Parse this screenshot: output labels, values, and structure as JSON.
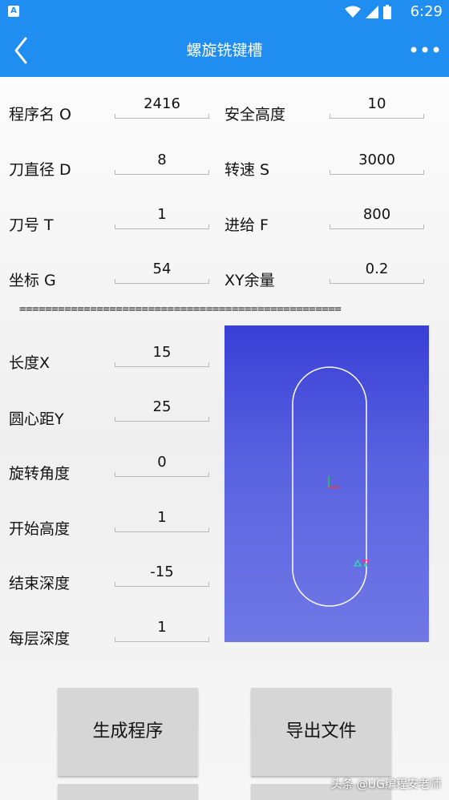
{
  "status_bar": {
    "time": "6:29",
    "app_icon": "A"
  },
  "app_bar": {
    "title": "螺旋铣键槽",
    "back_icon": "chevron-left-icon",
    "more_icon": "more-horizontal-icon"
  },
  "params_left": [
    {
      "label": "程序名 O",
      "value": "2416"
    },
    {
      "label": "刀直径 D",
      "value": "8"
    },
    {
      "label": "刀号 T",
      "value": "1"
    },
    {
      "label": "坐标 G",
      "value": "54"
    }
  ],
  "params_right": [
    {
      "label": "安全高度",
      "value": "10"
    },
    {
      "label": "转速 S",
      "value": "3000"
    },
    {
      "label": "进给 F",
      "value": "800"
    },
    {
      "label": "XY余量",
      "value": "0.2"
    }
  ],
  "separator": "==================================================",
  "slot_params": [
    {
      "label": "长度X",
      "value": "15"
    },
    {
      "label": "圆心距Y",
      "value": "25"
    },
    {
      "label": "旋转角度",
      "value": "0"
    },
    {
      "label": "开始高度",
      "value": "1"
    },
    {
      "label": "结束深度",
      "value": "-15"
    },
    {
      "label": "每层深度",
      "value": "1"
    }
  ],
  "buttons": {
    "generate": "生成程序",
    "export": "导出文件"
  },
  "watermark": "头条 @UG编程安老师"
}
